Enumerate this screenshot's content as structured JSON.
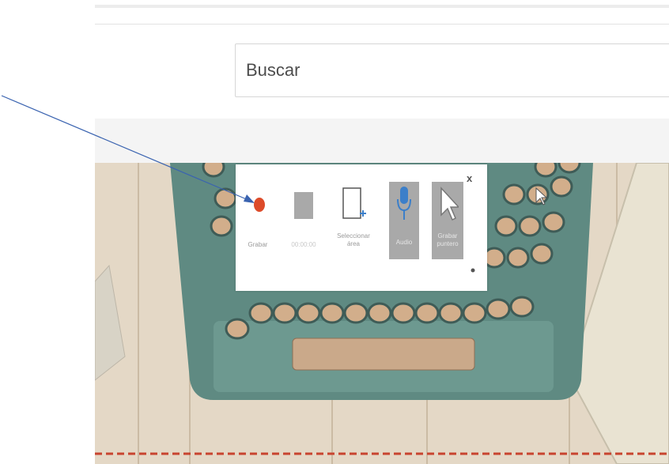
{
  "search": {
    "placeholder": "Buscar"
  },
  "recorder": {
    "record_label": "Grabar",
    "timer": "00:00:00",
    "select_area_label": "Seleccionar área",
    "audio_label": "Audio",
    "record_pointer_label": "Grabar puntero",
    "close_label": "x"
  },
  "colors": {
    "record": "#dd4b2a",
    "accent": "#3c7fc9",
    "arrow": "#3a63b0"
  },
  "icons": [
    "record-icon",
    "stop-icon",
    "select-area-icon",
    "microphone-icon",
    "pointer-icon",
    "close-icon",
    "arrow-annotation"
  ]
}
